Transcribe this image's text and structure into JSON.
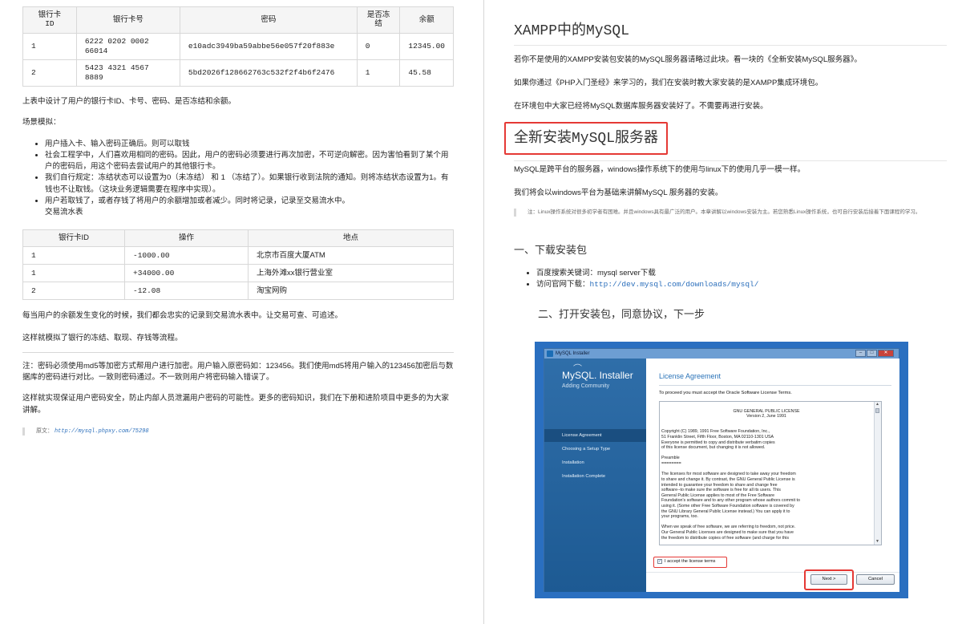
{
  "left": {
    "table1": {
      "headers": [
        "银行卡\nID",
        "银行卡号",
        "密码",
        "是否冻\n结",
        "余额"
      ],
      "rows": [
        [
          "1",
          "6222 0202 0002\n66014",
          "e10adc3949ba59abbe56e057f20f883e",
          "0",
          "12345.00"
        ],
        [
          "2",
          "5423 4321 4567\n8889",
          "5bd2026f128662763c532f2f4b6f2476",
          "1",
          "45.58"
        ]
      ]
    },
    "p_design": "上表中设计了用户的银行卡ID、卡号、密码、是否冻结和余额。",
    "p_scene": "场景模拟：",
    "scene_items": [
      "用户插入卡、输入密码正确后。则可以取钱",
      "社会工程学中，人们喜欢用相同的密码。因此，用户的密码必须要进行再次加密，不可逆向解密。因为害怕看到了某个用户的密码后，用这个密码去尝试用户的其他银行卡。",
      "我们自行规定：冻结状态可以设置为0（未冻结） 和 1 （冻结了）。如果银行收到法院的通知。则将冻结状态设置为1。有钱也不让取钱。（这块业务逻辑需要在程序中实现）。",
      "用户若取钱了，或者存钱了将用户的余额增加或者减少。同时将记录，记录至交易流水中。"
    ],
    "scene_tail": "交易流水表",
    "table2": {
      "headers": [
        "银行卡ID",
        "操作",
        "地点"
      ],
      "rows": [
        [
          "1",
          "-1000.00",
          "北京市百度大厦ATM"
        ],
        [
          "1",
          "+34000.00",
          "上海外滩xx银行营业室"
        ],
        [
          "2",
          "-12.08",
          "淘宝网购"
        ]
      ]
    },
    "p_record": "每当用户的余额发生变化的时候，我们都会忠实的记录到交易流水表中。让交易可查、可追述。",
    "p_simulate": "这样就模拟了银行的冻结、取现、存钱等流程。",
    "p_md5": "注：密码必须使用md5等加密方式帮用户进行加密。用户输入原密码如：123456。我们使用md5将用户输入的123456加密后与数据库的密码进行对比。一致则密码通过。不一致则用户将密码输入错误了。",
    "p_secure": "这样就实现保证用户密码安全，防止内部人员泄漏用户密码的可能性。更多的密码知识，我们在下册和进阶项目中更多的为大家讲解。",
    "source_label": "原文：",
    "source_link": "http://mysql.phpxy.com/75298"
  },
  "right": {
    "title": "XAMPP中的MySQL",
    "p1": "若你不是使用的XAMPP安装包安装的MySQL服务器请略过此块。看一块的《全新安装MySQL服务器》。",
    "p2": "如果你通过《PHP入门圣经》来学习的，我们在安装时教大家安装的是XAMPP集成环境包。",
    "p3": "在环境包中大家已经将MySQL数据库服务器安装好了。不需要再进行安装。",
    "h2": "全新安装MySQL服务器",
    "p4": "MySQL是跨平台的服务器，windows操作系统下的使用与linux下的使用几乎一模一样。",
    "p5": "我们将会以windows平台为基础来讲解MySQL 服务器的安装。",
    "note": "注：Linux操作系统对很多初学者有困难。并且windows具有最广泛的用户。本章讲解以windows安装为主。若您熟悉Linux操作系统，也可自行安装后接着下面课程的学习。",
    "h3": "一、下载安装包",
    "items": [
      {
        "text": "百度搜索关键词：mysql server下载",
        "link": ""
      },
      {
        "text": "访问官网下载：",
        "link": "http://dev.mysql.com/downloads/mysql/"
      }
    ],
    "h4": "二、打开安装包，同意协议，下一步"
  },
  "installer": {
    "window_title": "MySQL Installer",
    "logo": "MySQL. Installer",
    "logo_sub": "Adding Community",
    "steps": [
      "License Agreement",
      "Choosing a Setup Type",
      "Installation",
      "Installation Complete"
    ],
    "heading": "License Agreement",
    "intro": "To proceed you must accept the Oracle Software License Terms.",
    "license_head": "GNU GENERAL PUBLIC LICENSE\nVersion 2, June 1991",
    "license_body": "Copyright (C) 1989, 1991 Free Software Foundation, Inc.,\n51 Franklin Street, Fifth Floor, Boston, MA 02110-1301 USA\nEveryone is permitted to copy and distribute verbatim copies\nof this license document, but changing it is not allowed.\n\nPreamble\n========\n\nThe licenses for most software are designed to take away your freedom\nto share and change it.  By contrast, the GNU General Public License is\nintended to guarantee your freedom to share and change free\nsoftware--to make sure the software is free for all its users.  This\nGeneral Public License applies to most of the Free Software\nFoundation's software and to any other program whose authors commit to\nusing it.  (Some other Free Software Foundation software is covered by\nthe GNU Library General Public License instead.)  You can apply it to\nyour programs, too.\n\nWhen we speak of free software, we are referring to freedom, not price.\nOur General Public Licenses are designed to make sure that you have\nthe freedom to distribute copies of free software (and charge for this",
    "accept": "I accept the license terms",
    "next": "Next >",
    "cancel": "Cancel"
  }
}
